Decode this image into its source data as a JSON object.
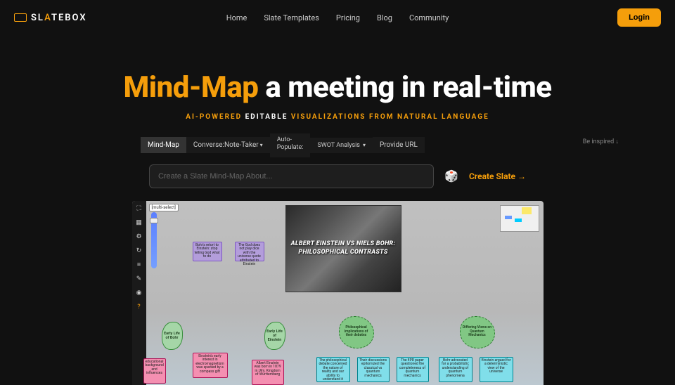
{
  "brand": {
    "pre": "SL",
    "accent": "A",
    "post": "TEBOX"
  },
  "nav": {
    "home": "Home",
    "templates": "Slate Templates",
    "pricing": "Pricing",
    "blog": "Blog",
    "community": "Community"
  },
  "login": "Login",
  "hero": {
    "accent": "Mind-Map",
    "rest": " a meeting in real-time",
    "tag_p1": "AI-POWERED ",
    "tag_p2": "EDITABLE ",
    "tag_p3": "VISUALIZATIONS FROM NATURAL LANGUAGE"
  },
  "tabs": {
    "mindmap": "Mind-Map",
    "converse": "Converse:Note-Taker",
    "auto_label": "Auto-",
    "auto_label2": "Populate:",
    "swot": "SWOT Analysis",
    "provide": "Provide URL",
    "inspired": "Be inspired ↓"
  },
  "input": {
    "placeholder": "Create a Slate Mind-Map About...",
    "create": "Create Slate →"
  },
  "canvas": {
    "multi_select": "[multi-select]",
    "photo_title": "ALBERT EINSTEIN VS NIELS BOHR: PHILOSOPHICAL CONTRASTS",
    "purple1": "Bohr's retort to Einstein: stop telling God what to do",
    "purple2": "The God does not play dice with the universe quote attributed to Einstein",
    "leaf1": "Early Life of Bohr",
    "leaf2": "Early Life of Einstein",
    "leaf3": "Philosophical Implications of their debates",
    "leaf4": "Differing Views on Quantum Mechanics",
    "info1": "educational background and influences",
    "info2": "Einstein's early interest in electromagnetism was sparked by a compass gift",
    "info3": "Albert Einstein was born in 1879 in Ulm, Kingdom of Württemberg",
    "info4": "The philosophical debate concerned the nature of reality and our ability to understand it",
    "info5": "Their discussions epitomized the classical vs quantum mechanics",
    "info6": "The EPR paper questioned the completeness of quantum mechanics",
    "info7": "Bohr advocated for a probabilistic understanding of quantum phenomena",
    "info8": "Einstein argued for a deterministic view of the universe"
  }
}
